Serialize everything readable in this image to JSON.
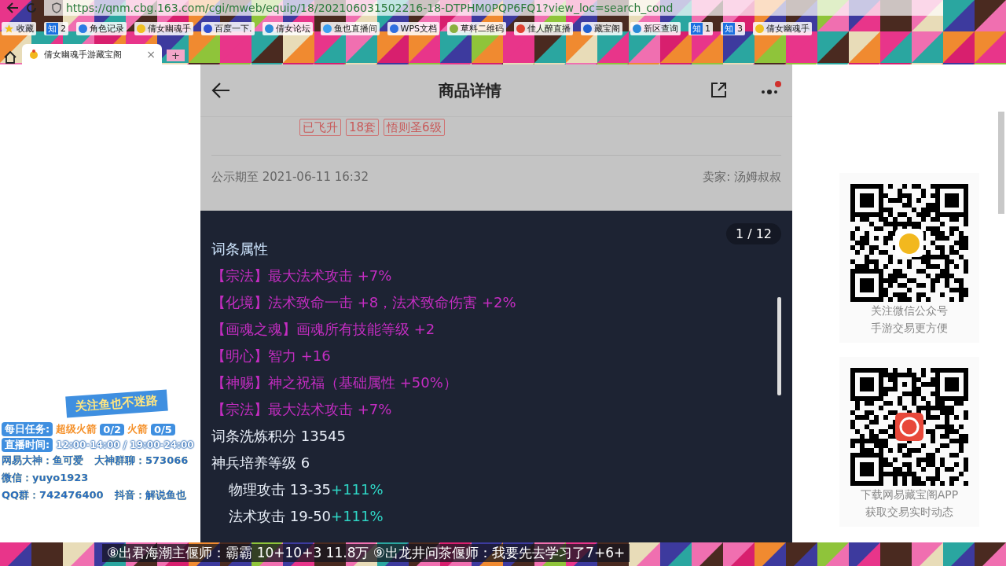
{
  "browser": {
    "url": "https://qnm.cbg.163.com/cgi/mweb/equip/18/202106031502216-18-DTPHM0PQP6FQ1?view_loc=search_cond",
    "bookmarks": [
      {
        "label": "收藏",
        "kind": "star"
      },
      {
        "label": "2",
        "kind": "badge",
        "badge": "知"
      },
      {
        "label": "角色记录",
        "kind": "dot",
        "color": "#2b7be4"
      },
      {
        "label": "倩女幽魂手",
        "kind": "dot",
        "color": "#f0c020"
      },
      {
        "label": "百度一下.",
        "kind": "dot",
        "color": "#3050d0"
      },
      {
        "label": "倩女论坛",
        "kind": "dot",
        "color": "#2a8ad8"
      },
      {
        "label": "鱼也直播间",
        "kind": "dot",
        "color": "#3aa0f0"
      },
      {
        "label": "WPS文档",
        "kind": "dot",
        "color": "#2f6fe0"
      },
      {
        "label": "草料二维码",
        "kind": "dot",
        "color": "#8ab040"
      },
      {
        "label": "佳人醉直播",
        "kind": "dot",
        "color": "#e04030"
      },
      {
        "label": "藏宝阁",
        "kind": "dot",
        "color": "#2060d0"
      },
      {
        "label": "新区查询",
        "kind": "dot",
        "color": "#2a8ad8"
      },
      {
        "label": "1",
        "kind": "badge",
        "badge": "知"
      },
      {
        "label": "3",
        "kind": "badge",
        "badge": "知"
      },
      {
        "label": "倩女幽魂手",
        "kind": "dot",
        "color": "#f0c020"
      }
    ],
    "tab": {
      "title": "倩女幽魂手游藏宝阁",
      "close": "×",
      "new_tab": "+"
    }
  },
  "page": {
    "header": {
      "title": "商品详情"
    },
    "tags": [
      "已飞升",
      "18套",
      "悟则圣6级"
    ],
    "notice": "公示期至 2021-06-11 16:32",
    "seller": "卖家: 汤姆叔叔",
    "viewer": {
      "counter": "1 / 12",
      "section_title": "词条属性",
      "attributes": [
        {
          "tag": "【宗法】",
          "text": "最大法术攻击 +7%"
        },
        {
          "tag": "【化境】",
          "text": "法术致命一击 +8，法术致命伤害 +2%"
        },
        {
          "tag": "【画魂之魂】",
          "text": "画魂所有技能等级 +2"
        },
        {
          "tag": "【明心】",
          "text": "智力 +16"
        },
        {
          "tag": "【神赐】",
          "text": "神之祝福（基础属性 +50%）"
        },
        {
          "tag": "【宗法】",
          "text": "最大法术攻击 +7%"
        }
      ],
      "stats": [
        {
          "label": "词条洗炼积分",
          "value": "13545"
        },
        {
          "label": "神兵培养等级",
          "value": "6"
        },
        {
          "label": "物理攻击",
          "value": "13-35",
          "bonus": "+111%"
        },
        {
          "label": "法术攻击",
          "value": "19-50",
          "bonus": "+111%"
        }
      ]
    }
  },
  "qr_cards": [
    {
      "lines": [
        "关注微信公众号",
        "手游交易更方便"
      ],
      "kind": "bell"
    },
    {
      "lines": [
        "下载网易藏宝阁APP",
        "获取交易实时动态"
      ],
      "kind": "app"
    }
  ],
  "stream_overlay": {
    "banner": "关注鱼也不迷路",
    "task_label": "每日任务:",
    "tasks": [
      {
        "label": "超级火箭",
        "count": "0/2"
      },
      {
        "label": "火箭",
        "count": "0/5"
      }
    ],
    "schedule_label": "直播时间:",
    "schedule": "12:00-14:00 / 19:00-24:00",
    "contacts": [
      "网易大神：鱼可爱",
      "大神群聊：573066",
      "微信：yuyo1923",
      "QQ群：742476400",
      "抖音：解说鱼也"
    ]
  },
  "ticker": "⑧出君海潮主偃师：霸霸  10+10+3  11.8万  ⑨出龙井问茶偃师：我要先去学习了7+6+"
}
